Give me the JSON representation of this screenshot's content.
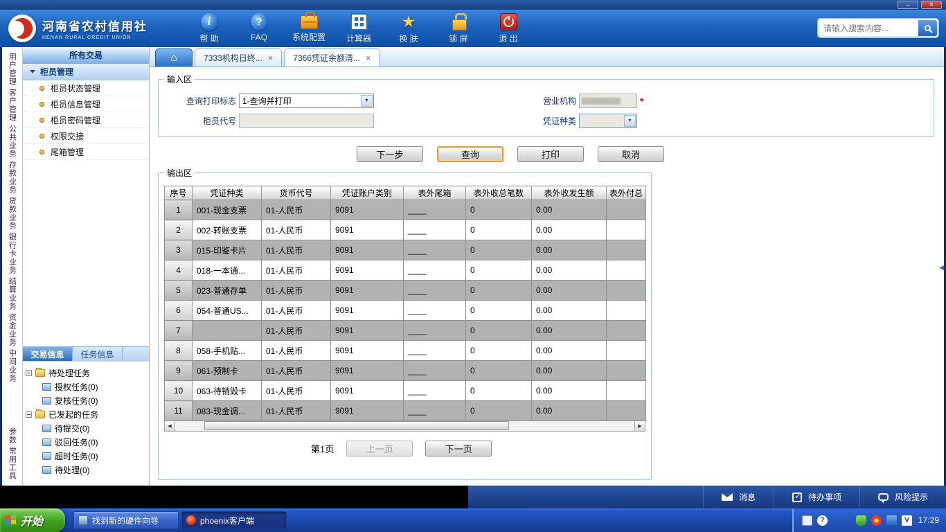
{
  "theme": {
    "header_blue": "#1c62bc",
    "accent_orange": "#ef9b3a",
    "row_gray": "#b2b2b2",
    "start_green": "#44a421",
    "taskbar_blue": "#1d49ac"
  },
  "header": {
    "logo": {
      "title": "河南省农村信用社",
      "subtitle": "HENAN RURAL CREDIT UNION"
    },
    "toolbar": [
      {
        "id": "help",
        "label": "帮 助"
      },
      {
        "id": "faq",
        "label": "FAQ"
      },
      {
        "id": "system-config",
        "label": "系统配置"
      },
      {
        "id": "calculator",
        "label": "计算器"
      },
      {
        "id": "skin",
        "label": "换 肤"
      },
      {
        "id": "lock-screen",
        "label": "锁 屏"
      },
      {
        "id": "exit",
        "label": "退 出"
      }
    ],
    "search": {
      "placeholder": "请输入搜索内容..."
    }
  },
  "vertical_tabs": [
    "用户管理",
    "客户管理",
    "公共业务",
    "存款业务",
    "贷款业务",
    "银行卡业务",
    "结算业务",
    "资金业务",
    "中间业务",
    "参数",
    "常用工具"
  ],
  "sidebar": {
    "title": "所有交易",
    "section": "柜员管理",
    "menu": [
      "柜员状态管理",
      "柜员信息管理",
      "柜员密码管理",
      "权限交接",
      "尾箱管理"
    ],
    "tabs": [
      {
        "label": "交易信息",
        "active": true
      },
      {
        "label": "任务信息",
        "active": false
      }
    ],
    "tree": [
      {
        "label": "待处理任务",
        "children": [
          "授权任务(0)",
          "复核任务(0)"
        ]
      },
      {
        "label": "已发起的任务",
        "children": [
          "待提交(0)",
          "驳回任务(0)",
          "超时任务(0)",
          "待处理(0)"
        ]
      }
    ]
  },
  "tab_bar": [
    {
      "label": "7333机构日终...",
      "active": false
    },
    {
      "label": "7366凭证余额清...",
      "active": true
    }
  ],
  "input_area": {
    "legend": "输入区",
    "query_print_flag": {
      "label": "查询打印标志",
      "value": "1-查询并打印"
    },
    "business_org": {
      "label": "营业机构",
      "value": "",
      "required": "*"
    },
    "teller_code": {
      "label": "柜员代号",
      "value": ""
    },
    "voucher_type": {
      "label": "凭证种类",
      "value": ""
    }
  },
  "actions": {
    "next": "下一步",
    "query": "查询",
    "print": "打印",
    "cancel": "取消"
  },
  "output_area": {
    "legend": "输出区",
    "table": {
      "headers": [
        "序号",
        "凭证种类",
        "货币代号",
        "凭证账户类别",
        "表外尾箱",
        "表外收总笔数",
        "表外收发生额",
        "表外付总"
      ],
      "rows": [
        [
          "1",
          "001-现金支票",
          "01-人民币",
          "9091",
          "____",
          "0",
          "0.00",
          ""
        ],
        [
          "2",
          "002-转账支票",
          "01-人民币",
          "9091",
          "____",
          "0",
          "0.00",
          ""
        ],
        [
          "3",
          "015-印鉴卡片",
          "01-人民币",
          "9091",
          "____",
          "0",
          "0.00",
          ""
        ],
        [
          "4",
          "018-一本通...",
          "01-人民币",
          "9091",
          "____",
          "0",
          "0.00",
          ""
        ],
        [
          "5",
          "023-普通存单",
          "01-人民币",
          "9091",
          "____",
          "0",
          "0.00",
          ""
        ],
        [
          "6",
          "054-普通US...",
          "01-人民币",
          "9091",
          "____",
          "0",
          "0.00",
          ""
        ],
        [
          "7",
          "",
          "01-人民币",
          "9091",
          "____",
          "0",
          "0.00",
          ""
        ],
        [
          "8",
          "058-手机贴...",
          "01-人民币",
          "9091",
          "____",
          "0",
          "0.00",
          ""
        ],
        [
          "9",
          "061-预制卡",
          "01-人民币",
          "9091",
          "____",
          "0",
          "0.00",
          ""
        ],
        [
          "10",
          "063-待销毁卡",
          "01-人民币",
          "9091",
          "____",
          "0",
          "0.00",
          ""
        ],
        [
          "11",
          "083-现金调...",
          "01-人民币",
          "9091",
          "____",
          "0",
          "0.00",
          ""
        ]
      ]
    },
    "pagination": {
      "page": "第1页",
      "prev": "上一页",
      "next": "下一页"
    }
  },
  "status_bar": [
    {
      "id": "message",
      "label": "消息"
    },
    {
      "id": "todo",
      "label": "待办事项"
    },
    {
      "id": "risk",
      "label": "风险提示"
    }
  ],
  "taskbar": {
    "start": "开始",
    "tasks": [
      {
        "id": "hardware",
        "label": "找到新的硬件向导",
        "active": false
      },
      {
        "id": "phoenix",
        "label": "phoenix客户端",
        "active": true
      }
    ],
    "clock": "17:29"
  }
}
